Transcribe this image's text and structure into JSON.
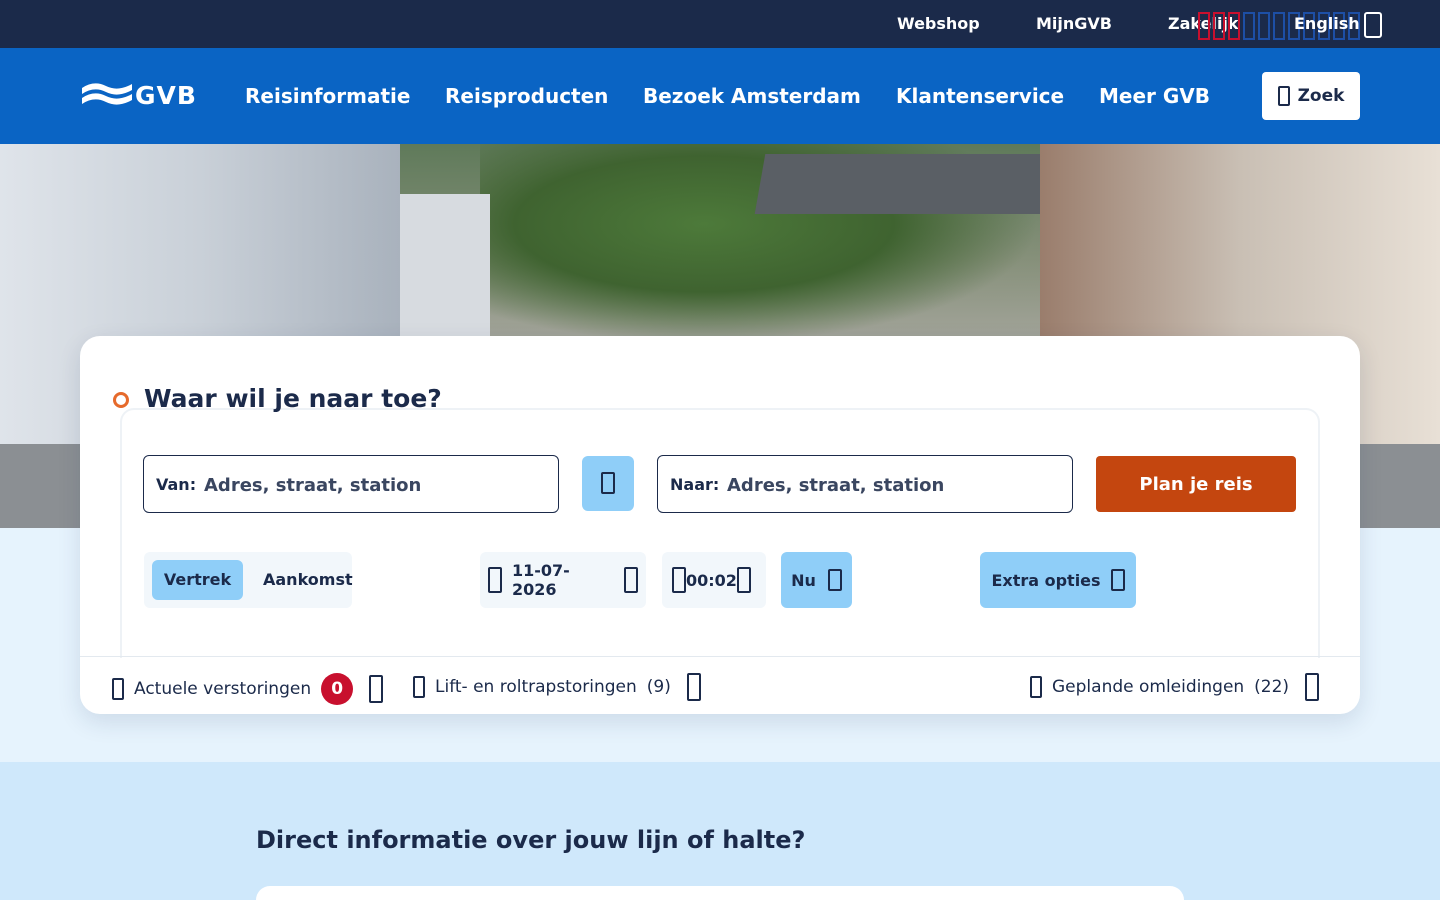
{
  "topbar": {
    "links": [
      "Webshop",
      "MijnGVB",
      "Zakelijk",
      "English"
    ],
    "icons": {
      "language": "globe-icon"
    }
  },
  "nav": {
    "logo_text": "GVB",
    "items": [
      "Reisinformatie",
      "Reisproducten",
      "Bezoek Amsterdam",
      "Klantenservice",
      "Meer GVB"
    ],
    "search_label": "Zoek"
  },
  "planner": {
    "title": "Waar wil je naar toe?",
    "from_label": "Van:",
    "from_placeholder": "Adres, straat, station",
    "to_label": "Naar:",
    "to_placeholder": "Adres, straat, station",
    "plan_button": "Plan je reis",
    "toggle": {
      "active": "Vertrek",
      "inactive": "Aankomst"
    },
    "date": "11-07-2026",
    "time": "00:02",
    "now_button": "Nu",
    "extra_button": "Extra opties"
  },
  "status_bar": {
    "disruptions_label": "Actuele verstoringen",
    "disruptions_count": "0",
    "lifts_label": "Lift- en roltrapstoringen",
    "lifts_count": "(9)",
    "diversions_label": "Geplande omleidingen",
    "diversions_count": "(22)"
  },
  "lower": {
    "title": "Direct informatie over jouw lijn of halte?"
  },
  "colors": {
    "navy": "#1b2a4a",
    "blue": "#0a64c4",
    "light_blue": "#8fcef8",
    "orange_red": "#c4460f",
    "badge_red": "#c8102e"
  }
}
